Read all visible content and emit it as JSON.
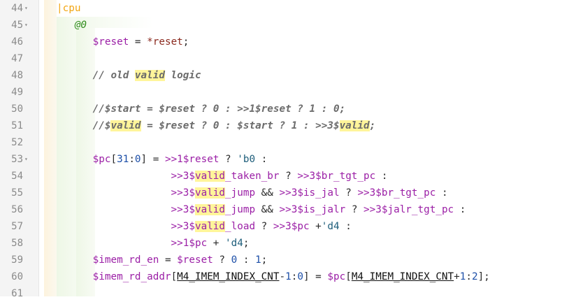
{
  "editor": {
    "lines": [
      {
        "n": "44",
        "fold": true,
        "parts": [
          {
            "t": "|cpu",
            "c": "pipe"
          }
        ]
      },
      {
        "n": "45",
        "fold": true,
        "parts": [
          {
            "t": "   "
          },
          {
            "t": "@0",
            "c": "stage"
          }
        ]
      },
      {
        "n": "46",
        "fold": false,
        "parts": [
          {
            "t": "      "
          },
          {
            "t": "$reset",
            "c": "sig"
          },
          {
            "t": " = "
          },
          {
            "t": "*reset",
            "c": "blt"
          },
          {
            "t": ";"
          }
        ]
      },
      {
        "n": "47",
        "fold": false,
        "parts": []
      },
      {
        "n": "48",
        "fold": false,
        "parts": [
          {
            "t": "      "
          },
          {
            "t": "// old ",
            "c": "cm"
          },
          {
            "t": "valid",
            "c": "cm hl"
          },
          {
            "t": " logic",
            "c": "cm"
          }
        ]
      },
      {
        "n": "49",
        "fold": false,
        "parts": []
      },
      {
        "n": "50",
        "fold": false,
        "parts": [
          {
            "t": "      "
          },
          {
            "t": "//$start = $reset ? 0 : >>1$reset ? 1 : 0;",
            "c": "cm"
          }
        ]
      },
      {
        "n": "51",
        "fold": false,
        "parts": [
          {
            "t": "      "
          },
          {
            "t": "//$",
            "c": "cm"
          },
          {
            "t": "valid",
            "c": "cm hl"
          },
          {
            "t": " = $reset ? 0 : $start ? 1 : >>3$",
            "c": "cm"
          },
          {
            "t": "valid",
            "c": "cm hl"
          },
          {
            "t": ";",
            "c": "cm"
          }
        ]
      },
      {
        "n": "52",
        "fold": false,
        "parts": []
      },
      {
        "n": "53",
        "fold": true,
        "parts": [
          {
            "t": "      "
          },
          {
            "t": "$pc",
            "c": "sig"
          },
          {
            "t": "["
          },
          {
            "t": "31",
            "c": "num"
          },
          {
            "t": ":"
          },
          {
            "t": "0",
            "c": "num"
          },
          {
            "t": "] = "
          },
          {
            "t": ">>1",
            "c": "sig"
          },
          {
            "t": "$reset",
            "c": "sig"
          },
          {
            "t": " ? "
          },
          {
            "t": "'b0",
            "c": "lit"
          },
          {
            "t": " :"
          }
        ]
      },
      {
        "n": "54",
        "fold": false,
        "parts": [
          {
            "t": "                   "
          },
          {
            "t": ">>3",
            "c": "sig"
          },
          {
            "t": "$",
            "c": "sig"
          },
          {
            "t": "valid",
            "c": "sig hl"
          },
          {
            "t": "_taken_br",
            "c": "sig"
          },
          {
            "t": " ? "
          },
          {
            "t": ">>3",
            "c": "sig"
          },
          {
            "t": "$br_tgt_pc",
            "c": "sig"
          },
          {
            "t": " :"
          }
        ]
      },
      {
        "n": "55",
        "fold": false,
        "parts": [
          {
            "t": "                   "
          },
          {
            "t": ">>3",
            "c": "sig"
          },
          {
            "t": "$",
            "c": "sig"
          },
          {
            "t": "valid",
            "c": "sig hl"
          },
          {
            "t": "_jump",
            "c": "sig"
          },
          {
            "t": " && "
          },
          {
            "t": ">>3",
            "c": "sig"
          },
          {
            "t": "$is_jal",
            "c": "sig"
          },
          {
            "t": " ? "
          },
          {
            "t": ">>3",
            "c": "sig"
          },
          {
            "t": "$br_tgt_pc",
            "c": "sig"
          },
          {
            "t": " :"
          }
        ]
      },
      {
        "n": "56",
        "fold": false,
        "parts": [
          {
            "t": "                   "
          },
          {
            "t": ">>3",
            "c": "sig"
          },
          {
            "t": "$",
            "c": "sig"
          },
          {
            "t": "valid",
            "c": "sig hl"
          },
          {
            "t": "_jump",
            "c": "sig"
          },
          {
            "t": " && "
          },
          {
            "t": ">>3",
            "c": "sig"
          },
          {
            "t": "$is_jalr",
            "c": "sig"
          },
          {
            "t": " ? "
          },
          {
            "t": ">>3",
            "c": "sig"
          },
          {
            "t": "$jalr_tgt_pc",
            "c": "sig"
          },
          {
            "t": " :"
          }
        ]
      },
      {
        "n": "57",
        "fold": false,
        "parts": [
          {
            "t": "                   "
          },
          {
            "t": ">>3",
            "c": "sig"
          },
          {
            "t": "$",
            "c": "sig"
          },
          {
            "t": "valid",
            "c": "sig hl"
          },
          {
            "t": "_load",
            "c": "sig"
          },
          {
            "t": " ? "
          },
          {
            "t": ">>3",
            "c": "sig"
          },
          {
            "t": "$pc",
            "c": "sig"
          },
          {
            "t": " +"
          },
          {
            "t": "'d4",
            "c": "lit"
          },
          {
            "t": " :"
          }
        ]
      },
      {
        "n": "58",
        "fold": false,
        "parts": [
          {
            "t": "                   "
          },
          {
            "t": ">>1",
            "c": "sig"
          },
          {
            "t": "$pc",
            "c": "sig"
          },
          {
            "t": " + "
          },
          {
            "t": "'d4",
            "c": "lit"
          },
          {
            "t": ";"
          }
        ]
      },
      {
        "n": "59",
        "fold": false,
        "parts": [
          {
            "t": "      "
          },
          {
            "t": "$imem_rd_en",
            "c": "sig"
          },
          {
            "t": " = "
          },
          {
            "t": "$reset",
            "c": "sig"
          },
          {
            "t": " ? "
          },
          {
            "t": "0",
            "c": "num"
          },
          {
            "t": " : "
          },
          {
            "t": "1",
            "c": "num"
          },
          {
            "t": ";"
          }
        ]
      },
      {
        "n": "60",
        "fold": false,
        "parts": [
          {
            "t": "      "
          },
          {
            "t": "$imem_rd_addr",
            "c": "sig"
          },
          {
            "t": "["
          },
          {
            "t": "M4_IMEM_INDEX_CNT",
            "c": "cst"
          },
          {
            "t": "-"
          },
          {
            "t": "1",
            "c": "num"
          },
          {
            "t": ":"
          },
          {
            "t": "0",
            "c": "num"
          },
          {
            "t": "] = "
          },
          {
            "t": "$pc",
            "c": "sig"
          },
          {
            "t": "["
          },
          {
            "t": "M4_IMEM_INDEX_CNT",
            "c": "cst"
          },
          {
            "t": "+"
          },
          {
            "t": "1",
            "c": "num"
          },
          {
            "t": ":"
          },
          {
            "t": "2",
            "c": "num"
          },
          {
            "t": "];"
          }
        ]
      },
      {
        "n": "61",
        "fold": false,
        "parts": []
      }
    ]
  }
}
